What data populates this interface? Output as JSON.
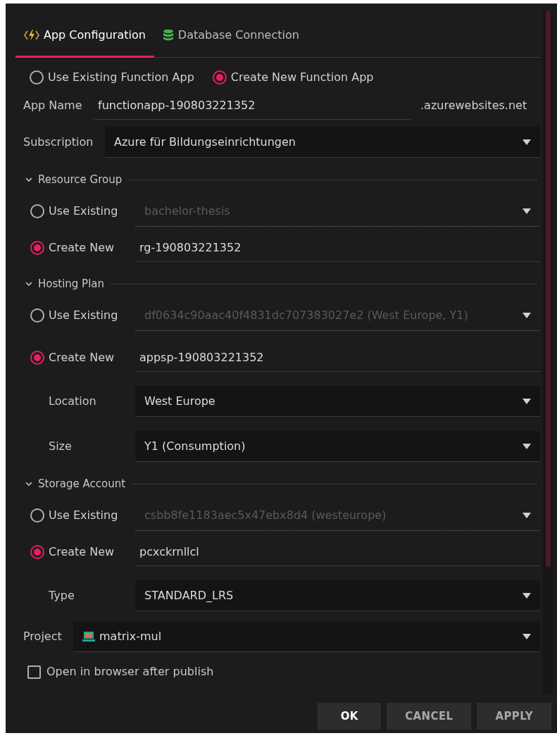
{
  "tabs": [
    {
      "label": "App Configuration",
      "kind": "function",
      "selected": true
    },
    {
      "label": "Database Connection",
      "kind": "database",
      "selected": false
    }
  ],
  "app_mode": [
    {
      "label": "Use Existing Function App",
      "selected": false
    },
    {
      "label": "Create New Function App",
      "selected": true
    }
  ],
  "app_name": {
    "label": "App Name",
    "value": "functionapp-190803221352",
    "suffix": ".azurewebsites.net"
  },
  "subscription": {
    "label": "Subscription",
    "value": "Azure für Bildungseinrichtungen"
  },
  "sections": [
    {
      "title": "Resource Group",
      "expanded": true,
      "rows": [
        {
          "kind": "radio_dropdown",
          "label": "Use Existing",
          "selected": false,
          "value": "bachelor-thesis"
        },
        {
          "kind": "radio_input",
          "label": "Create New",
          "selected": true,
          "value": "rg-190803221352"
        }
      ]
    },
    {
      "title": "Hosting Plan",
      "expanded": true,
      "rows": [
        {
          "kind": "radio_dropdown",
          "label": "Use Existing",
          "selected": false,
          "value": "df0634c90aac40f4831dc707383027e2 (West Europe, Y1)"
        },
        {
          "kind": "radio_input",
          "label": "Create New",
          "selected": true,
          "value": "appsp-190803221352"
        },
        {
          "kind": "dropdown",
          "label": "Location",
          "value": "West Europe"
        },
        {
          "kind": "dropdown",
          "label": "Size",
          "value": "Y1 (Consumption)"
        }
      ]
    },
    {
      "title": "Storage Account",
      "expanded": true,
      "rows": [
        {
          "kind": "radio_dropdown",
          "label": "Use Existing",
          "selected": false,
          "value": "csbb8fe1183aec5x47ebx8d4 (westeurope)"
        },
        {
          "kind": "radio_input",
          "label": "Create New",
          "selected": true,
          "value": "pcxckrnllcl"
        },
        {
          "kind": "dropdown",
          "label": "Type",
          "value": "STANDARD_LRS"
        }
      ]
    }
  ],
  "project": {
    "label": "Project",
    "value": "matrix-mul"
  },
  "open_in_browser": {
    "label": "Open in browser after publish",
    "checked": false
  },
  "buttons": [
    {
      "label": "OK",
      "primary": true
    },
    {
      "label": "CANCEL",
      "primary": false
    },
    {
      "label": "APPLY",
      "primary": false
    }
  ]
}
